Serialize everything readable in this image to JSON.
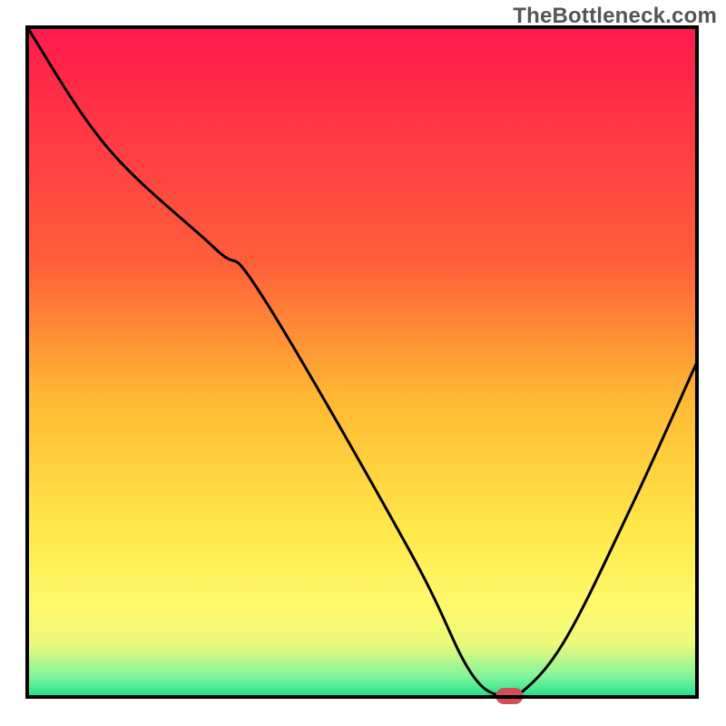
{
  "watermark": "TheBottleneck.com",
  "chart_data": {
    "type": "line",
    "title": "",
    "xlabel": "",
    "ylabel": "",
    "xlim": [
      0,
      100
    ],
    "ylim": [
      0,
      100
    ],
    "series": [
      {
        "name": "curve",
        "x": [
          0,
          12,
          28,
          35,
          57,
          66,
          71,
          73,
          80,
          90,
          100
        ],
        "values": [
          100,
          82,
          67,
          60,
          22,
          4,
          0,
          0,
          8,
          28,
          50
        ]
      }
    ],
    "marker": {
      "name": "marker",
      "x": 72,
      "y": 0
    },
    "gradient_stops": [
      {
        "offset": 0,
        "color": "#ff1a4d"
      },
      {
        "offset": 35,
        "color": "#ff5e3a"
      },
      {
        "offset": 55,
        "color": "#ffb733"
      },
      {
        "offset": 75,
        "color": "#ffe84a"
      },
      {
        "offset": 86,
        "color": "#fff96b"
      },
      {
        "offset": 92,
        "color": "#edf97a"
      },
      {
        "offset": 97,
        "color": "#7ff59b"
      },
      {
        "offset": 100,
        "color": "#1ee08a"
      }
    ]
  }
}
